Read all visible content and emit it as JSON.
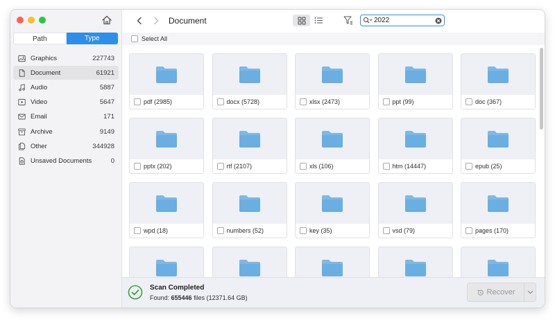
{
  "sidebar": {
    "tabs": [
      {
        "label": "Path"
      },
      {
        "label": "Type"
      }
    ],
    "categories": [
      {
        "label": "Graphics",
        "count": "227743",
        "icon": "image-icon"
      },
      {
        "label": "Document",
        "count": "61921",
        "icon": "document-icon",
        "selected": true
      },
      {
        "label": "Audio",
        "count": "5887",
        "icon": "music-note-icon"
      },
      {
        "label": "Video",
        "count": "5647",
        "icon": "video-icon"
      },
      {
        "label": "Email",
        "count": "171",
        "icon": "mail-icon"
      },
      {
        "label": "Archive",
        "count": "9149",
        "icon": "archive-icon"
      },
      {
        "label": "Other",
        "count": "344928",
        "icon": "other-files-icon"
      },
      {
        "label": "Unsaved Documents",
        "count": "0",
        "icon": "unsaved-document-icon"
      }
    ]
  },
  "toolbar": {
    "title": "Document",
    "search_value": "2022"
  },
  "select_all_label": "Select All",
  "folders": [
    {
      "label": "pdf (2985)"
    },
    {
      "label": "docx (5728)"
    },
    {
      "label": "xlsx (2473)"
    },
    {
      "label": "ppt (99)"
    },
    {
      "label": "doc (367)"
    },
    {
      "label": "pptx (202)"
    },
    {
      "label": "rtf (2107)"
    },
    {
      "label": "xls (106)"
    },
    {
      "label": "htm (14447)"
    },
    {
      "label": "epub (25)"
    },
    {
      "label": "wpd (18)"
    },
    {
      "label": "numbers (52)"
    },
    {
      "label": "key (35)"
    },
    {
      "label": "vsd (79)"
    },
    {
      "label": "pages (170)"
    },
    {
      "label": ""
    },
    {
      "label": ""
    },
    {
      "label": ""
    },
    {
      "label": ""
    },
    {
      "label": ""
    }
  ],
  "status": {
    "title": "Scan Completed",
    "found_prefix": "Found: ",
    "found_count": "655446",
    "found_suffix": " files (12371.64 GB)"
  },
  "recover_label": "Recover",
  "colors": {
    "accent": "#2f8fe8",
    "folder": "#6aaee2",
    "success": "#3aa435"
  }
}
